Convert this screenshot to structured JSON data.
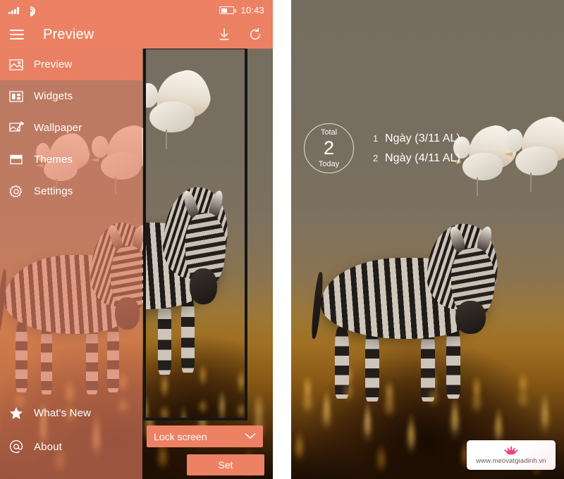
{
  "app": {
    "title": "Preview",
    "accent_color": "#ec8164",
    "sidebar_color": "#e9a394",
    "panel_bg": "#8a8a8a",
    "wallpaper_sky": "#756d5f",
    "wallpaper_grass": "#a06f23"
  },
  "statusbar": {
    "signal_icon": "signal-bars-icon",
    "wifi_icon": "wifi-icon",
    "battery_icon": "battery-icon",
    "battery_level_pct": 40,
    "time": "10:43"
  },
  "titlebar": {
    "menu_icon": "hamburger-menu-icon",
    "title": "Preview",
    "download_icon": "download-icon",
    "refresh_icon": "refresh-icon"
  },
  "sidebar": {
    "items": [
      {
        "label": "Preview",
        "icon": "image-icon",
        "active": true
      },
      {
        "label": "Widgets",
        "icon": "widgets-icon",
        "active": false
      },
      {
        "label": "Wallpaper",
        "icon": "wallpaper-icon",
        "active": false
      },
      {
        "label": "Themes",
        "icon": "themes-icon",
        "active": false
      },
      {
        "label": "Settings",
        "icon": "gear-icon",
        "active": false
      }
    ],
    "bottom_items": [
      {
        "label": "What's New",
        "icon": "star-icon"
      },
      {
        "label": "About",
        "icon": "at-sign-icon"
      }
    ]
  },
  "bottom_controls": {
    "target_dropdown": {
      "value": "Lock screen",
      "caret_icon": "chevron-down-icon",
      "options": [
        "Lock screen"
      ]
    },
    "set_button": "Set"
  },
  "lockscreen": {
    "total_widget": {
      "top_label": "Total",
      "count": "2",
      "bottom_label": "Today"
    },
    "events": [
      {
        "index": "1",
        "text": "Ngày (3/11 AL)"
      },
      {
        "index": "2",
        "text": "Ngày (4/11 AL)"
      }
    ]
  },
  "watermark": {
    "logo_icon": "lotus-flower-icon",
    "url": "www.meovatgiadinh.vn"
  }
}
